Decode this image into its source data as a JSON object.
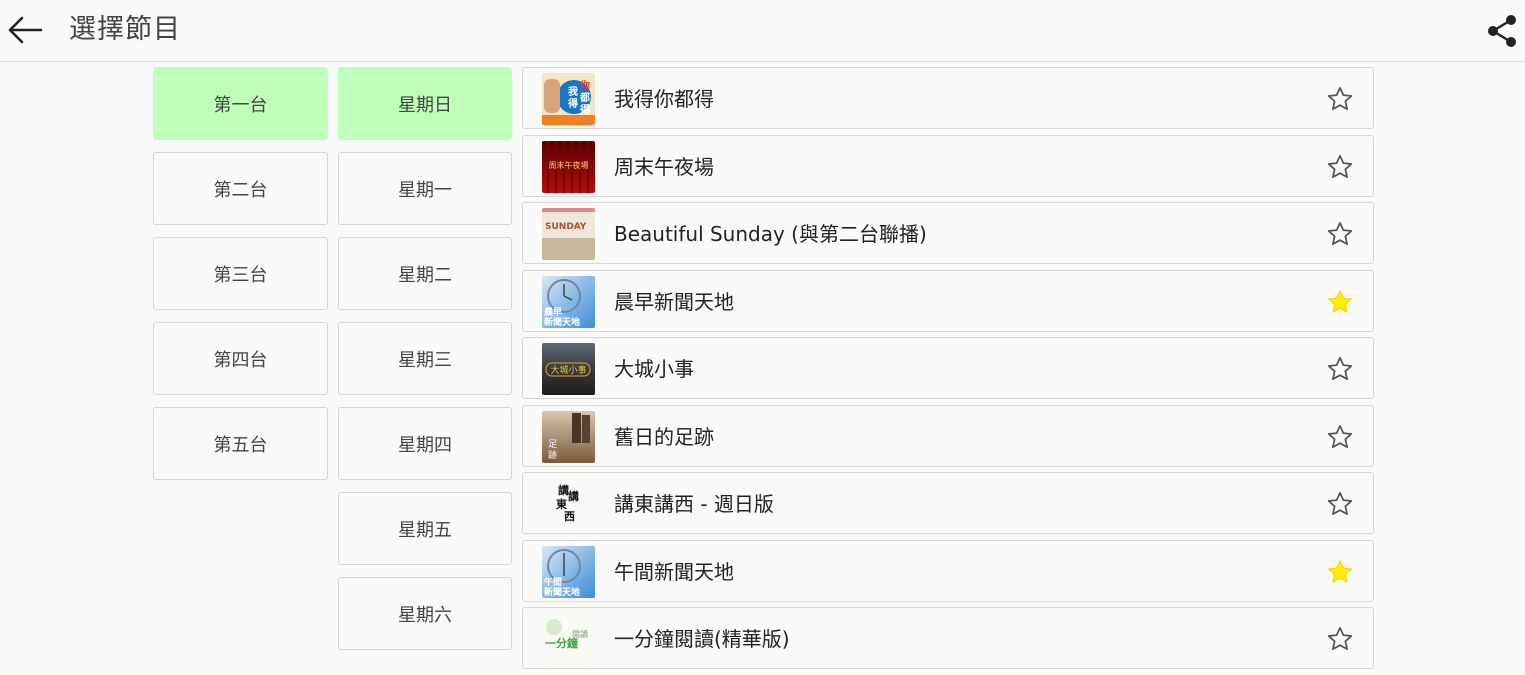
{
  "header": {
    "title": "選擇節目",
    "back_icon": "arrow-left-icon",
    "share_icon": "share-icon"
  },
  "channels": [
    {
      "label": "第一台",
      "selected": true
    },
    {
      "label": "第二台",
      "selected": false
    },
    {
      "label": "第三台",
      "selected": false
    },
    {
      "label": "第四台",
      "selected": false
    },
    {
      "label": "第五台",
      "selected": false
    }
  ],
  "days": [
    {
      "label": "星期日",
      "selected": true
    },
    {
      "label": "星期一",
      "selected": false
    },
    {
      "label": "星期二",
      "selected": false
    },
    {
      "label": "星期三",
      "selected": false
    },
    {
      "label": "星期四",
      "selected": false
    },
    {
      "label": "星期五",
      "selected": false
    },
    {
      "label": "星期六",
      "selected": false
    }
  ],
  "programs": [
    {
      "name": "我得你都得",
      "favorite": false,
      "thumb_text": "我得你都得"
    },
    {
      "name": "周末午夜場",
      "favorite": false,
      "thumb_text": "周末午夜場"
    },
    {
      "name": "Beautiful Sunday (與第二台聯播)",
      "favorite": false,
      "thumb_text": "SUNDAY"
    },
    {
      "name": "晨早新聞天地",
      "favorite": true,
      "thumb_text": "晨早新聞天地"
    },
    {
      "name": "大城小事",
      "favorite": false,
      "thumb_text": "大城小事"
    },
    {
      "name": "舊日的足跡",
      "favorite": false,
      "thumb_text": "足跡"
    },
    {
      "name": "講東講西 - 週日版",
      "favorite": false,
      "thumb_text": "講東講西"
    },
    {
      "name": "午間新聞天地",
      "favorite": true,
      "thumb_text": "午間新聞天地"
    },
    {
      "name": "一分鐘閱讀(精華版)",
      "favorite": false,
      "thumb_text": "一分鐘閱讀"
    }
  ],
  "colors": {
    "selected_tile": "#bfffbc",
    "favorite_star": "#ffee00",
    "empty_star_stroke": "#555555"
  }
}
